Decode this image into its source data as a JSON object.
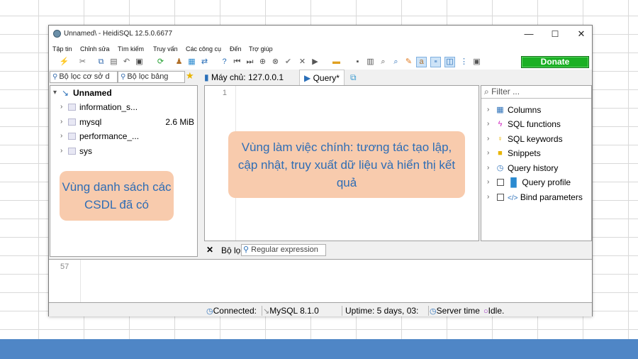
{
  "window": {
    "title": "Unnamed\\ - HeidiSQL 12.5.0.6677",
    "minimize": "—",
    "maximize": "☐",
    "close": "✕"
  },
  "menu": [
    "Tập tin",
    "Chỉnh sửa",
    "Tìm kiếm",
    "Truy vấn",
    "Các công cụ",
    "Đến",
    "Trợ giúp"
  ],
  "toolbar": {
    "donate_label": "Donate"
  },
  "left": {
    "db_filter_placeholder": "Bộ lọc cơ sở d",
    "table_filter_placeholder": "Bộ lọc bảng",
    "root": "Unnamed",
    "databases": [
      {
        "name": "information_s...",
        "size": ""
      },
      {
        "name": "mysql",
        "size": "2.6 MiB"
      },
      {
        "name": "performance_...",
        "size": ""
      },
      {
        "name": "sys",
        "size": ""
      }
    ]
  },
  "tabs": {
    "host_label": "Máy chủ: 127.0.0.1",
    "query_label": "Query*"
  },
  "editor": {
    "line_number": "1"
  },
  "helpers": {
    "filter_placeholder": "Filter ...",
    "items": [
      "Columns",
      "SQL functions",
      "SQL keywords",
      "Snippets",
      "Query history",
      "Query profile",
      "Bind parameters"
    ]
  },
  "filter_tabs": {
    "filter_label": "Bộ lọ",
    "regex_label": "Regular expression"
  },
  "log": {
    "line_number": "57"
  },
  "status": {
    "connected": "Connected:",
    "server_version": "MySQL 8.1.0",
    "uptime": "Uptime: 5 days, 03:",
    "server_time": "Server time",
    "idle": "Idle."
  },
  "annotations": {
    "left_note": "Vùng danh sách các CSDL đã có",
    "main_note": "Vùng làm việc chính: tương tác tạo lập, cập nhật, truy xuất dữ liệu và hiển thị kết quả"
  },
  "colors": {
    "donate_green": "#1bb024",
    "callout_fill": "#f8cbad",
    "callout_text": "#2e6db5",
    "bottom_band": "#4f86c6"
  }
}
